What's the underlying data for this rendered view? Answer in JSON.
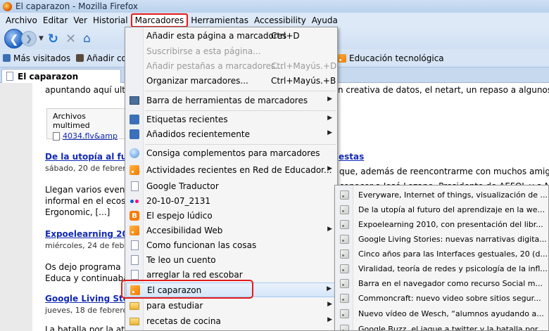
{
  "window": {
    "title": "El caparazon - Mozilla Firefox"
  },
  "menubar": [
    "Archivo",
    "Editar",
    "Ver",
    "Historial",
    "Marcadores",
    "Herramientas",
    "Accessibility",
    "Ayuda"
  ],
  "bookmarks_toolbar": {
    "mas_visitados": "Más visitados",
    "anadir": "Añadir cor",
    "educacion": "Educación tecnológica"
  },
  "tab": {
    "title": "El caparazon"
  },
  "content": {
    "line0": "apuntando aquí ulti",
    "line0_right": "n creativa de datos, el netart, un repaso a algunos de",
    "archivos": "Archivos multimed",
    "archivo_link": "4034.flv&amp",
    "post1_title": "De la utopía al fu",
    "post1_title_right": "estas",
    "post1_date": "sábado, 20 de febrero",
    "post1_right1": "que, además de reencontrarme con muchos amigos/",
    "post1_body1": "Llegan varios event",
    "post1_right2": "conocer a José Lozano, Presidente de AEFOL y a Ma",
    "post1_body2": "informal en el ecosi",
    "post1_body3": "Ergonomic, [...]",
    "post2_title": "Expoelearning 20",
    "post2_date": "miércoles, 24 de febre",
    "post2_body1": "Os dejo programa",
    "post2_body2": "Educa y continuaba",
    "post3_title": "Google Living Sto",
    "post3_date": "jueves, 18 de febrero",
    "post3_body1": "La batalla por la ate"
  },
  "menu": {
    "anadir_pagina": "Añadir esta página a marcadores",
    "anadir_pagina_sc": "Ctrl+D",
    "suscribirse": "Suscribirse a esta página...",
    "anadir_pestanas": "Añadir pestañas a marcadores...",
    "anadir_pestanas_sc": "Ctrl+Mayús.+D",
    "organizar": "Organizar marcadores...",
    "organizar_sc": "Ctrl+Mayús.+B",
    "barra": "Barra de herramientas de marcadores",
    "etiquetas": "Etiquetas recientes",
    "anadidos": "Añadidos recientemente",
    "consiga": "Consiga complementos para marcadores",
    "actividades": "Actividades recientes en Red de Educador...",
    "google_traductor": "Google Traductor",
    "fecha": "20-10-07_2131",
    "espejo": "El espejo lúdico",
    "accesibilidad": "Accesibilidad Web",
    "como": "Como funcionan las cosas",
    "teleo": "Te leo un cuento",
    "arreglar": "arreglar la red escobar",
    "caparazon": "El caparazon",
    "estudiar": "para estudiar",
    "recetas": "recetas de cocina"
  },
  "submenu": [
    "Everyware, Internet of things, visualización de ...",
    "De la utopía al futuro del aprendizaje en la we...",
    "Expoelearning 2010, con presentación del libr...",
    "Google Living Stories: nuevas narrativas digita...",
    "Cinco años para las Interfaces gestuales, 20 (d...",
    "Viralidad, teoría de redes y psicología de la infl...",
    "Barra en el navegador como recurso Social m...",
    "Commoncraft: nuevo video sobre sitios segur...",
    "Nuevo vídeo de Wesch, “alumnos ayudando a...",
    "Google Buzz, el jaque a twitter y la batalla por ..."
  ],
  "colors": {
    "highlight": "#e21b1b",
    "link": "#1229b8",
    "menubar_bg": "#dde9f7"
  }
}
